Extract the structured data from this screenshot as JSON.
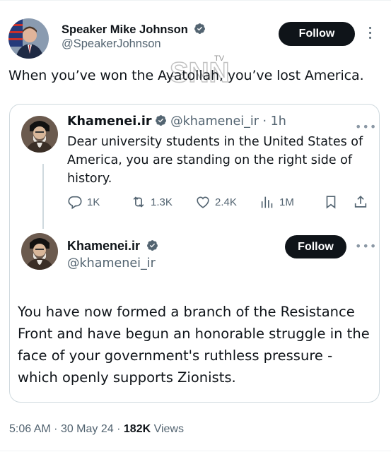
{
  "outer_tweet": {
    "author_name": "Speaker Mike Johnson",
    "author_handle": "@SpeakerJohnson",
    "follow_label": "Follow",
    "text": "When you’ve won the Ayatollah, you’ve lost America."
  },
  "quoted_thread": {
    "tweet1": {
      "author_name": "Khamenei.ir",
      "author_handle": "@khamenei_ir",
      "separator": "·",
      "age": "1h",
      "more": "•••",
      "text": "Dear university students in the United States of America, you are standing on the right side of history.",
      "replies": "1K",
      "retweets": "1.3K",
      "likes": "2.4K",
      "views": "1M"
    },
    "tweet2": {
      "author_name": "Khamenei.ir",
      "author_handle": "@khamenei_ir",
      "follow_label": "Follow",
      "more": "•••",
      "text": "You have now formed a branch of the Resistance Front and have begun an honorable struggle in the face of your government's ruthless pressure - which openly supports Zionists."
    }
  },
  "footer": {
    "time": "5:06 AM",
    "date": "30 May 24",
    "separator": "·",
    "views_count": "182K",
    "views_label": "Views"
  },
  "watermark": {
    "text": "TV"
  },
  "colors": {
    "verified_blue": "#1d9bf0",
    "text_primary": "#0f1419",
    "text_secondary": "#536471",
    "border": "#cfd9de",
    "follow_button": "#0f1419"
  },
  "icons": [
    "verified-badge-icon",
    "kebab-menu-icon",
    "reply-icon",
    "retweet-icon",
    "like-icon",
    "views-icon",
    "bookmark-icon",
    "share-icon"
  ]
}
